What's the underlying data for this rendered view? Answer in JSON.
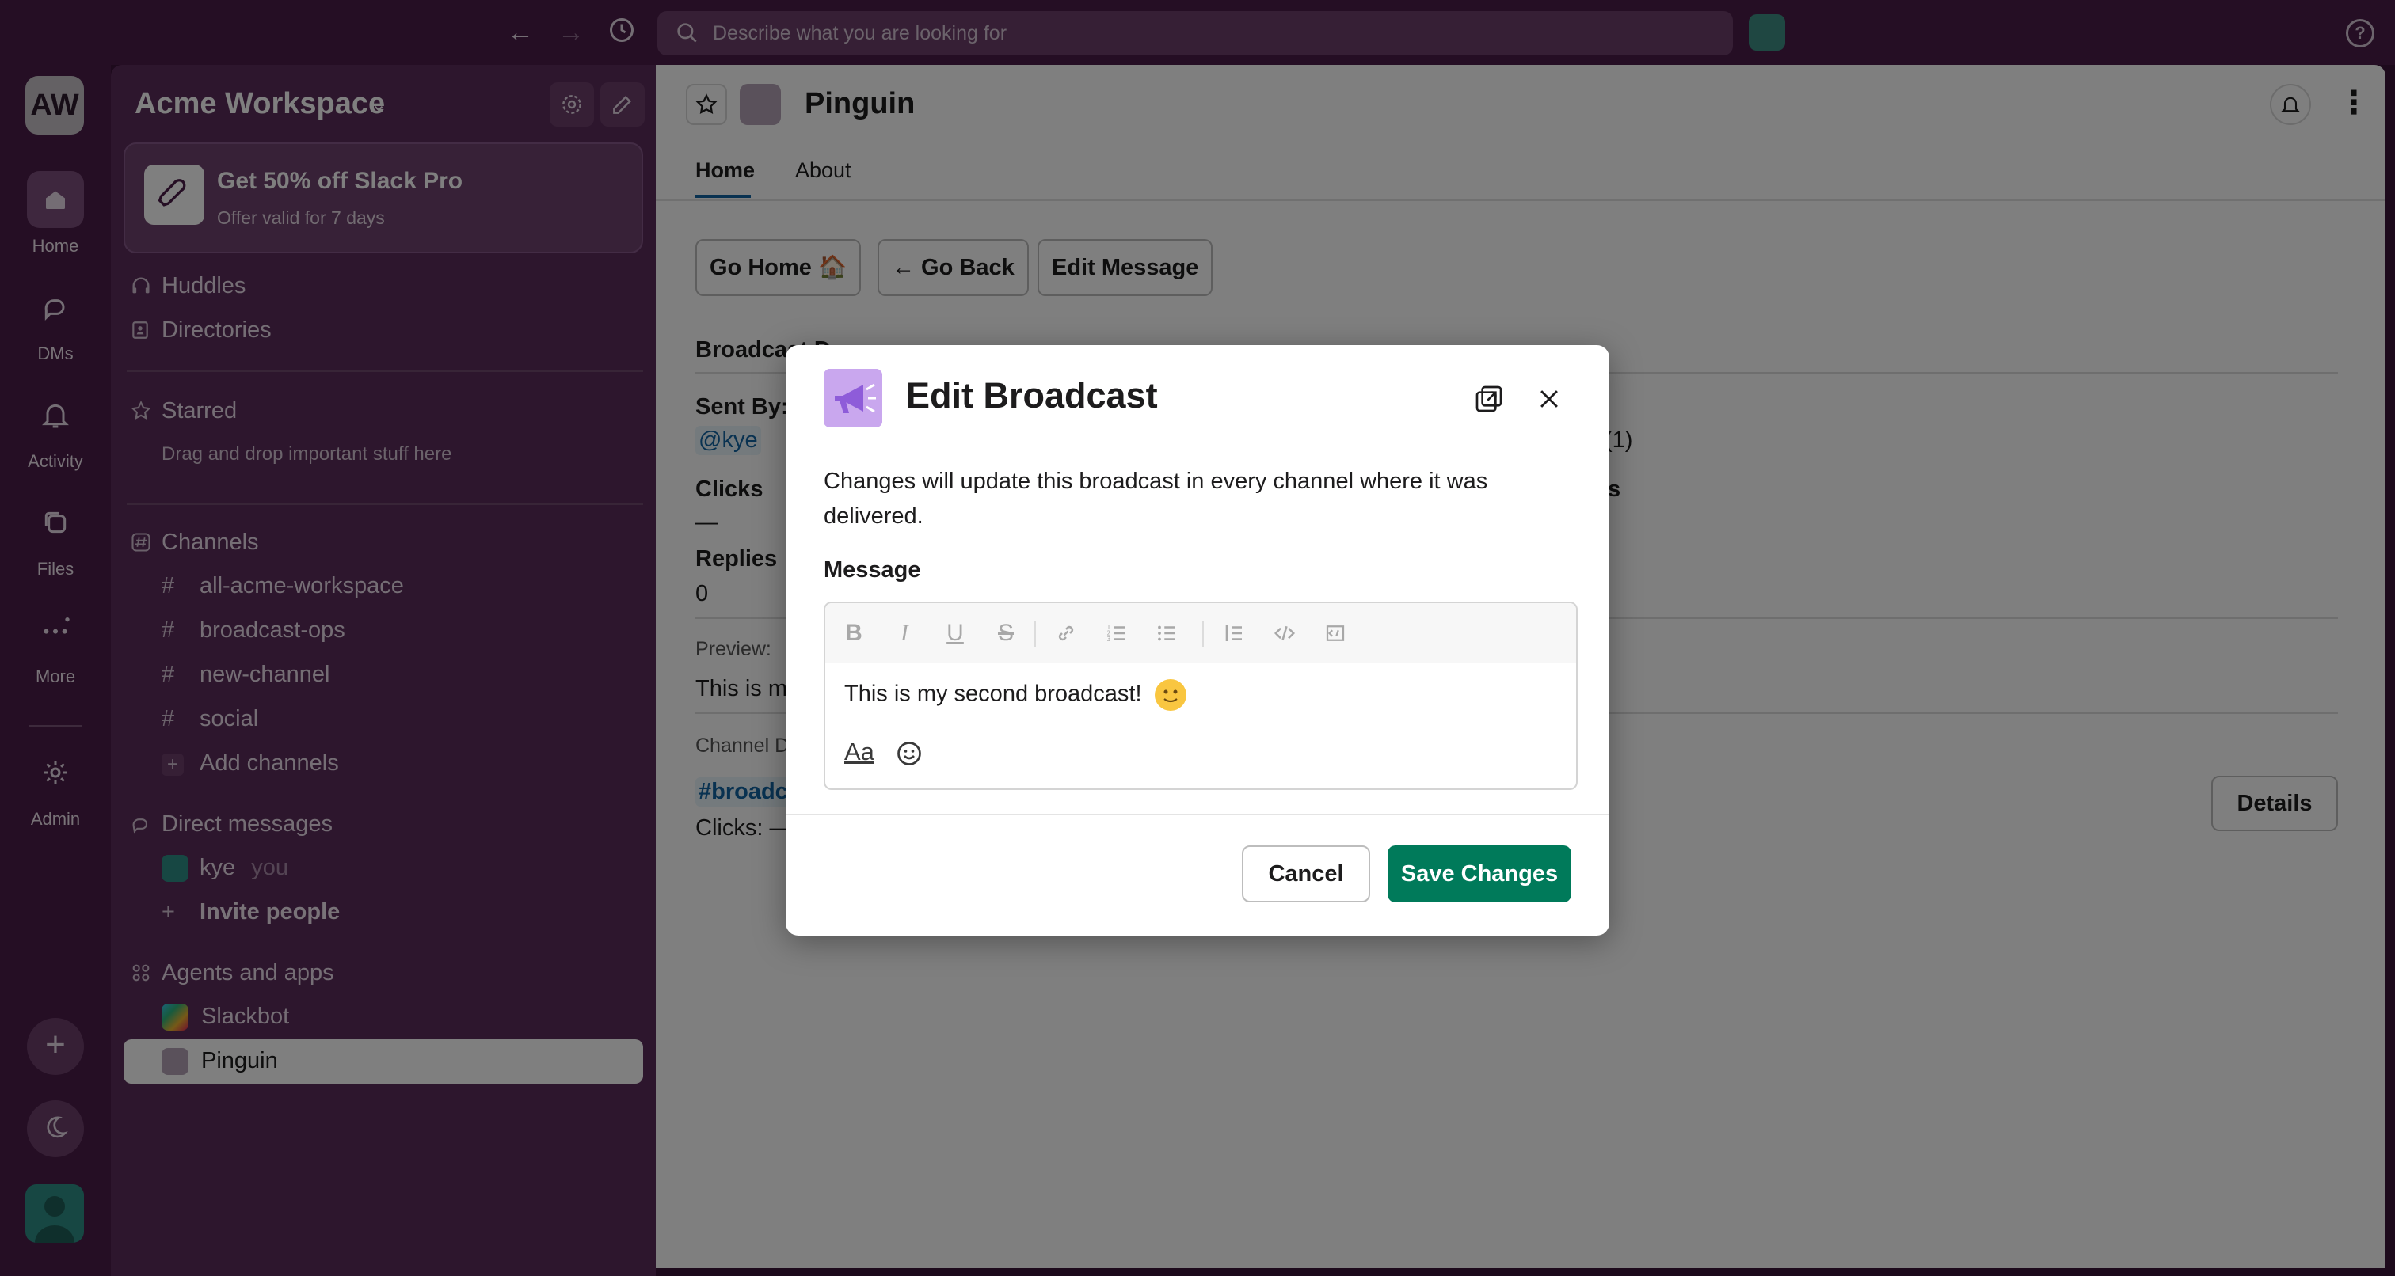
{
  "topbar": {
    "search_placeholder": "Describe what you are looking for",
    "back_icon": "arrow-left-icon",
    "forward_icon": "arrow-right-icon",
    "history_icon": "clock-icon",
    "help_icon": "question-circle-icon",
    "help_glyph": "?"
  },
  "rail": {
    "workspace_initials": "AW",
    "items": [
      {
        "label": "Home",
        "icon": "home-icon"
      },
      {
        "label": "DMs",
        "icon": "dms-icon"
      },
      {
        "label": "Activity",
        "icon": "bell-icon"
      },
      {
        "label": "Files",
        "icon": "files-icon"
      },
      {
        "label": "More",
        "icon": "more-icon"
      },
      {
        "label": "Admin",
        "icon": "gear-icon"
      }
    ],
    "add_glyph": "+"
  },
  "sidebar": {
    "workspace_name": "Acme Workspace",
    "promo": {
      "title": "Get 50% off Slack Pro",
      "subtitle": "Offer valid for 7 days"
    },
    "huddles": "Huddles",
    "directories": "Directories",
    "starred": "Starred",
    "starred_note": "Drag and drop important stuff here",
    "channels_header": "Channels",
    "channels": [
      "all-acme-workspace",
      "broadcast-ops",
      "new-channel",
      "social"
    ],
    "add_channels": "Add channels",
    "dm_header": "Direct messages",
    "dm_user": "kye",
    "dm_you": "you",
    "invite_people": "Invite people",
    "apps_header": "Agents and apps",
    "apps": [
      "Slackbot",
      "Pinguin"
    ]
  },
  "main": {
    "app_title": "Pinguin",
    "tabs": [
      "Home",
      "About"
    ],
    "buttons": [
      "Go Home 🏠",
      "← Go Back",
      "Edit Message"
    ],
    "broadcast_heading": "Broadcast D",
    "sent_by_label": "Sent By:",
    "sent_by_value": "@kye",
    "clicks_label": "Clicks",
    "clicks_value": "—",
    "replies_label": "Replies",
    "replies_value": "0",
    "preview_label": "Preview:",
    "preview_text": "This is m",
    "channel_label": "Channel D",
    "channel_link": "#broadc",
    "channel_clicks": "Clicks: —",
    "partial_1": "(1)",
    "partial_2": "s",
    "details_button": "Details"
  },
  "modal": {
    "title": "Edit Broadcast",
    "description": "Changes will update this broadcast in every channel where it was delivered.",
    "message_label": "Message",
    "message_text": "This is my second broadcast!",
    "format_label": "Aa",
    "toolbar": {
      "bold": "B",
      "italic": "I",
      "underline": "U",
      "strike": "S"
    },
    "cancel": "Cancel",
    "save": "Save Changes"
  },
  "colors": {
    "aubergine": "#4a1d48",
    "sidebar": "#5b2c5a",
    "primary_green": "#007a5a",
    "link_blue": "#1264a3"
  }
}
